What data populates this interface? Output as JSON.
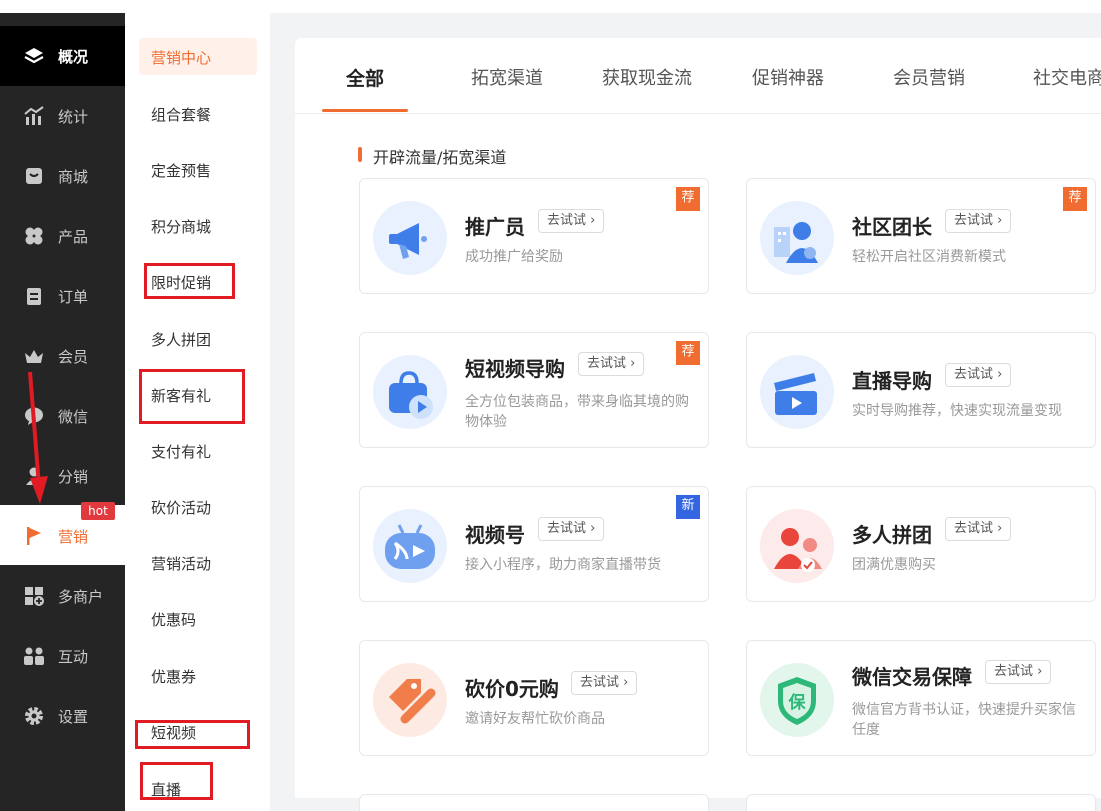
{
  "primary_nav": [
    {
      "label": "概况",
      "icon": "layers-icon"
    },
    {
      "label": "统计",
      "icon": "stats-icon"
    },
    {
      "label": "商城",
      "icon": "mall-icon"
    },
    {
      "label": "产品",
      "icon": "product-icon"
    },
    {
      "label": "订单",
      "icon": "order-icon"
    },
    {
      "label": "会员",
      "icon": "crown-icon"
    },
    {
      "label": "微信",
      "icon": "wechat-icon"
    },
    {
      "label": "分销",
      "icon": "user-icon"
    },
    {
      "label": "营销",
      "icon": "flag-icon"
    },
    {
      "label": "多商户",
      "icon": "store-icon"
    },
    {
      "label": "互动",
      "icon": "people-icon"
    },
    {
      "label": "设置",
      "icon": "gear-icon"
    }
  ],
  "hot_badge": "hot",
  "sub_nav": [
    "营销中心",
    "组合套餐",
    "定金预售",
    "积分商城",
    "限时促销",
    "多人拼团",
    "新客有礼",
    "支付有礼",
    "砍价活动",
    "营销活动",
    "优惠码",
    "优惠券",
    "短视频",
    "直播"
  ],
  "tabs": [
    "全部",
    "拓宽渠道",
    "获取现金流",
    "促销神器",
    "会员营销",
    "社交电商"
  ],
  "section_title": "开辟流量/拓宽渠道",
  "try_label": "去试试",
  "try_arrow": "›",
  "cards": [
    {
      "title": "推广员",
      "desc": "成功推广给奖励",
      "badge": "荐"
    },
    {
      "title": "社区团长",
      "desc": "轻松开启社区消费新模式",
      "badge": "荐"
    },
    {
      "title": "短视频导购",
      "desc": "全方位包装商品，带来身临其境的购物体验",
      "badge": "荐"
    },
    {
      "title": "直播导购",
      "desc": "实时导购推荐，快速实现流量变现",
      "badge": ""
    },
    {
      "title": "视频号",
      "desc": "接入小程序，助力商家直播带货",
      "badge": "新"
    },
    {
      "title": "多人拼团",
      "desc": "团满优惠购买",
      "badge": ""
    },
    {
      "title": "砍价0元购",
      "desc": "邀请好友帮忙砍价商品",
      "badge": ""
    },
    {
      "title": "微信交易保障",
      "desc": "微信官方背书认证，快速提升买家信任度",
      "badge": ""
    }
  ],
  "colors": {
    "accent": "#f06c30",
    "sidebar": "#252525",
    "highlight_red": "#e01b23",
    "new_badge": "#3366e0"
  },
  "shield_char": "保"
}
